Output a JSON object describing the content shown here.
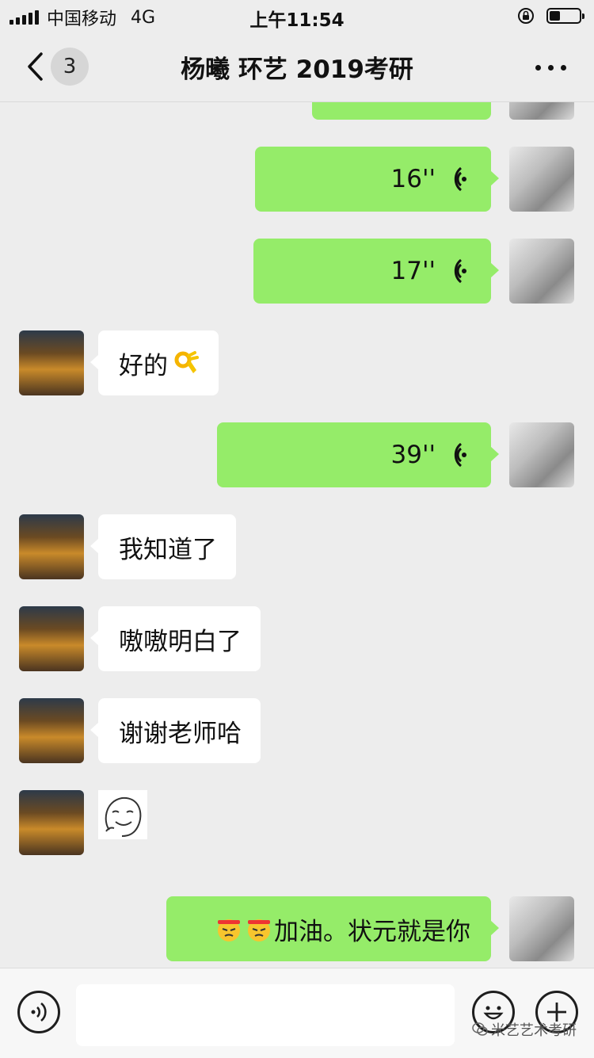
{
  "status_bar": {
    "carrier": "中国移动",
    "network": "4G",
    "time": "上午11:54",
    "battery_level": 0.35
  },
  "nav": {
    "back_count": "3",
    "title": "杨曦 环艺 2019考研"
  },
  "messages": [
    {
      "side": "out",
      "type": "voice",
      "duration": "16''"
    },
    {
      "side": "out",
      "type": "voice",
      "duration": "17''"
    },
    {
      "side": "in",
      "type": "text",
      "text": "好的",
      "emoji": "ok-hand-emoji"
    },
    {
      "side": "out",
      "type": "voice",
      "duration": "39''"
    },
    {
      "side": "in",
      "type": "text",
      "text": "我知道了"
    },
    {
      "side": "in",
      "type": "text",
      "text": "嗷嗷明白了"
    },
    {
      "side": "in",
      "type": "text",
      "text": "谢谢老师哈"
    },
    {
      "side": "in",
      "type": "sticker",
      "sticker": "smiling-face-sticker"
    },
    {
      "side": "out",
      "type": "text",
      "text": "加油。状元就是你",
      "emoji": "determined-face-emoji"
    }
  ],
  "input_bar": {
    "watermark": "米艺艺术考研"
  },
  "colors": {
    "outgoing_bubble": "#95ec69",
    "incoming_bubble": "#ffffff",
    "background": "#ededed"
  }
}
